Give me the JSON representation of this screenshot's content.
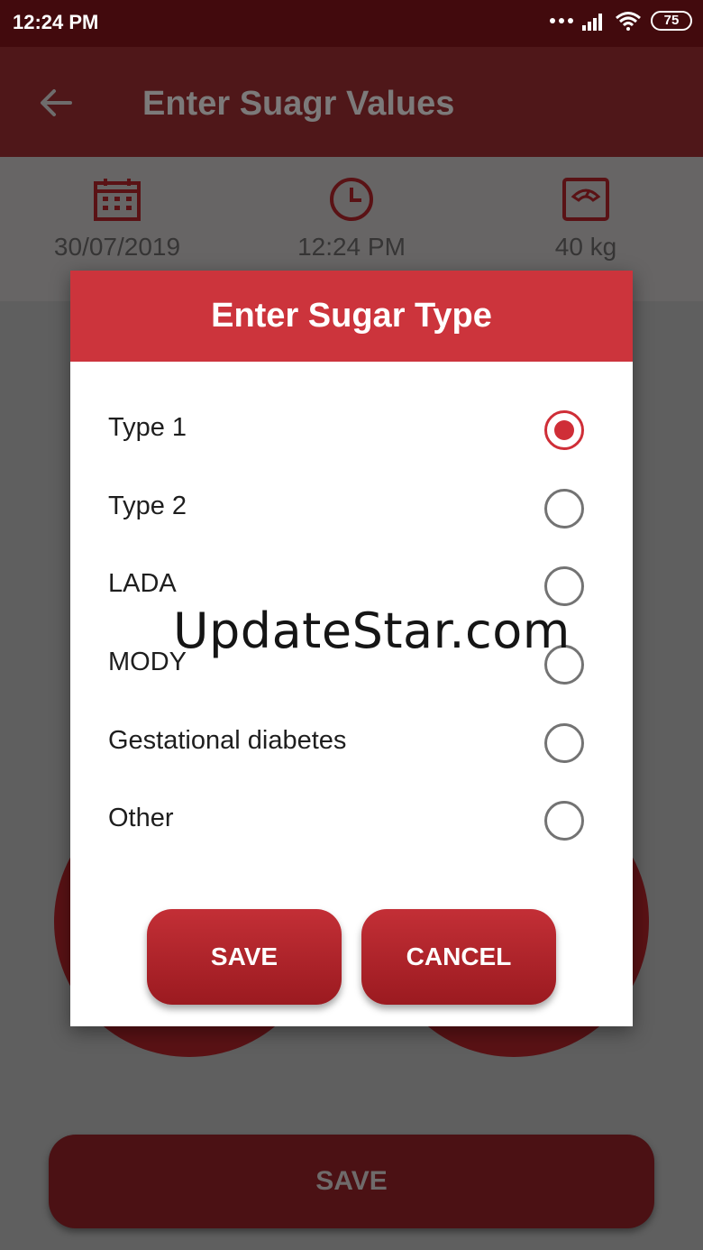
{
  "status_bar": {
    "time": "12:24 PM",
    "battery": "75"
  },
  "app_bar": {
    "title": "Enter Suagr Values"
  },
  "info": {
    "date": "30/07/2019",
    "time": "12:24 PM",
    "weight": "40 kg"
  },
  "bottom": {
    "save_label": "SAVE"
  },
  "dialog": {
    "title": "Enter Sugar Type",
    "options": [
      {
        "label": "Type 1",
        "checked": true
      },
      {
        "label": "Type 2",
        "checked": false
      },
      {
        "label": "LADA",
        "checked": false
      },
      {
        "label": "MODY",
        "checked": false
      },
      {
        "label": "Gestational diabetes",
        "checked": false
      },
      {
        "label": "Other",
        "checked": false
      }
    ],
    "save_label": "SAVE",
    "cancel_label": "CANCEL"
  },
  "watermark": "UpdateStar.com",
  "colors": {
    "primary": "#cc343c",
    "status_bar": "#420a0d",
    "overlay": "#5f5f5f"
  },
  "icons": [
    "back-arrow-icon",
    "calendar-icon",
    "clock-icon",
    "scale-icon",
    "wifi-icon",
    "signal-icon",
    "battery-icon"
  ]
}
